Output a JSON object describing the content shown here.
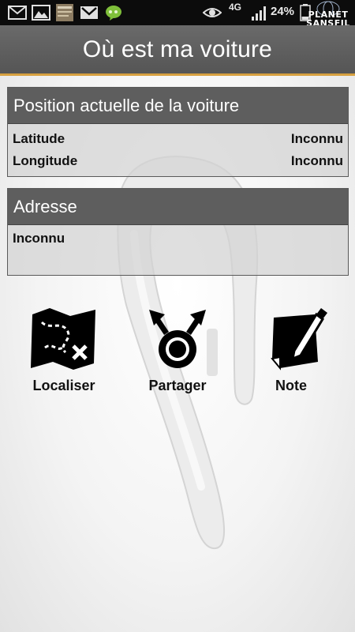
{
  "status_bar": {
    "network": "4G",
    "battery": "24%",
    "watermark_line1": "PLANET",
    "watermark_line2": "SANSFIL",
    "icons": [
      "email-icon",
      "image-icon",
      "notification-thumbnail-icon",
      "gmail-icon",
      "hangouts-icon",
      "eye-icon",
      "signal-icon",
      "battery-icon"
    ]
  },
  "app": {
    "title": "Où est ma voiture"
  },
  "position_panel": {
    "title": "Position actuelle de la voiture",
    "latitude_label": "Latitude",
    "latitude_value": "Inconnu",
    "longitude_label": "Longitude",
    "longitude_value": "Inconnu"
  },
  "address_panel": {
    "title": "Adresse",
    "value": "Inconnu"
  },
  "actions": {
    "locate": {
      "label": "Localiser",
      "icon": "treasure-map-icon"
    },
    "share": {
      "label": "Partager",
      "icon": "share-icon"
    },
    "note": {
      "label": "Note",
      "icon": "note-icon"
    }
  }
}
